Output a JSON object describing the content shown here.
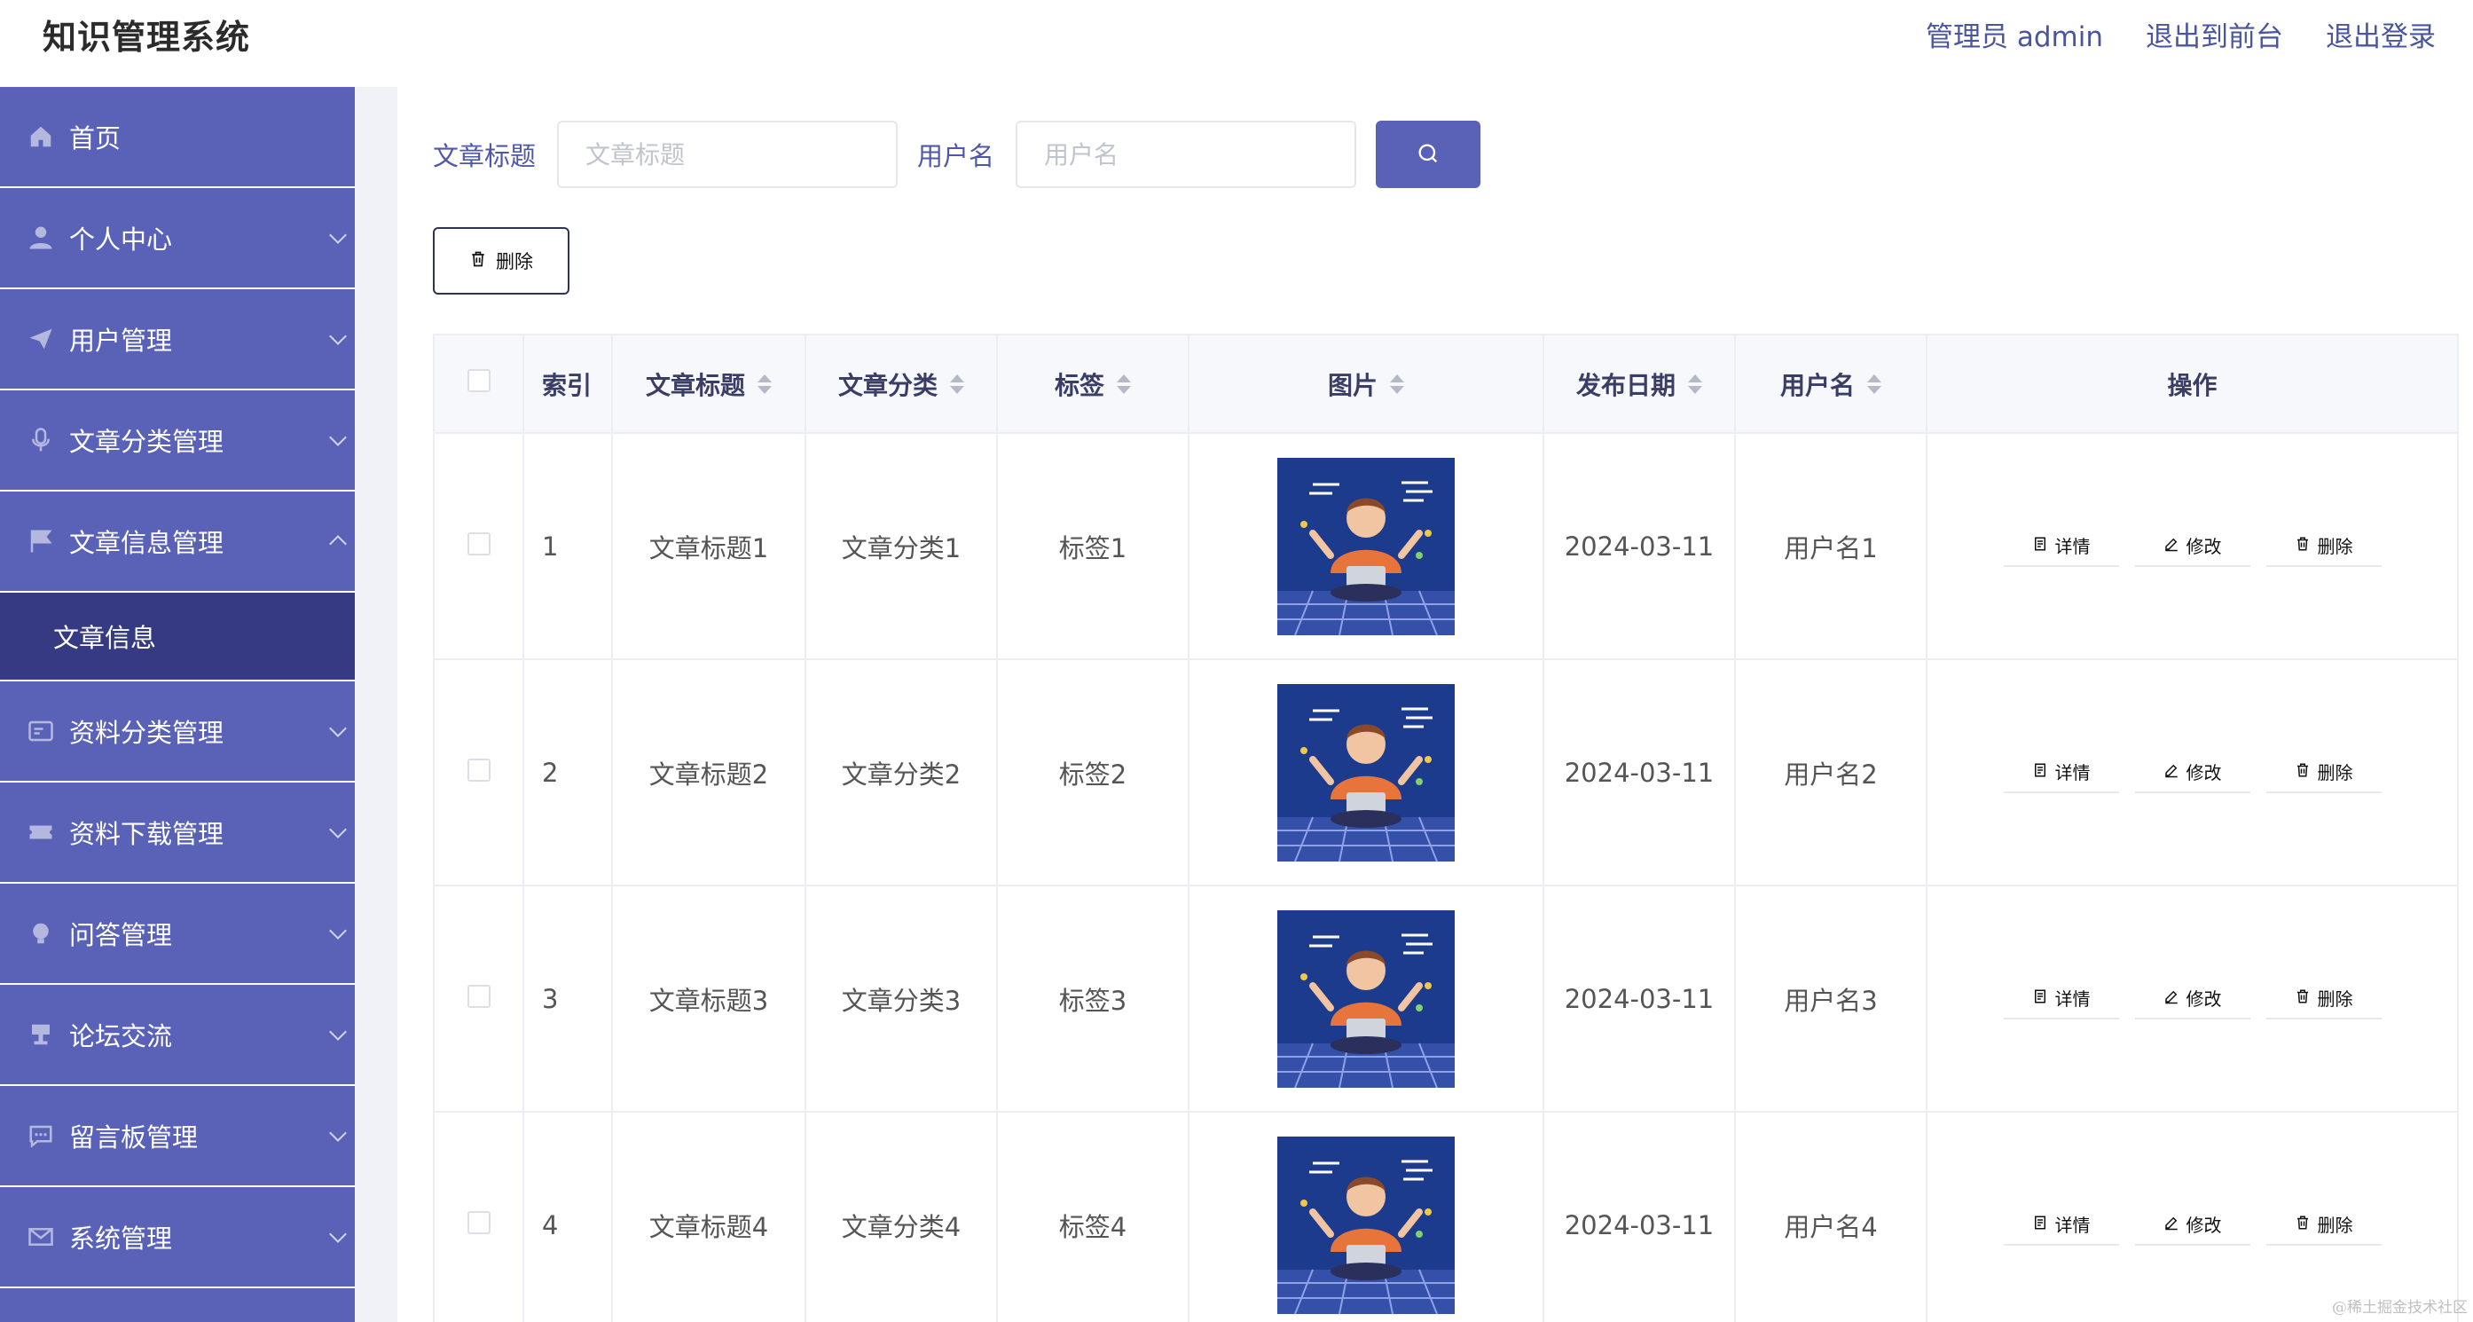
{
  "header": {
    "app_title": "知识管理系统",
    "admin_label": "管理员 admin",
    "back_to_front": "退出到前台",
    "logout": "退出登录"
  },
  "sidebar": {
    "items": [
      {
        "label": "首页",
        "icon": "home-icon"
      },
      {
        "label": "个人中心",
        "icon": "user-icon"
      },
      {
        "label": "用户管理",
        "icon": "paper-plane-icon"
      },
      {
        "label": "文章分类管理",
        "icon": "microphone-icon"
      },
      {
        "label": "文章信息管理",
        "icon": "flag-icon"
      },
      {
        "label": "资料分类管理",
        "icon": "id-card-icon"
      },
      {
        "label": "资料下载管理",
        "icon": "ticket-icon"
      },
      {
        "label": "问答管理",
        "icon": "bulb-icon"
      },
      {
        "label": "论坛交流",
        "icon": "stamp-icon"
      },
      {
        "label": "留言板管理",
        "icon": "chat-icon"
      },
      {
        "label": "系统管理",
        "icon": "mail-icon"
      }
    ],
    "sub_item": "文章信息"
  },
  "search": {
    "title_label": "文章标题",
    "title_placeholder": "文章标题",
    "user_label": "用户名",
    "user_placeholder": "用户名"
  },
  "toolbar": {
    "delete_label": "删除"
  },
  "table": {
    "columns": [
      "索引",
      "文章标题",
      "文章分类",
      "标签",
      "图片",
      "发布日期",
      "用户名",
      "操作"
    ],
    "rows": [
      {
        "index": "1",
        "title": "文章标题1",
        "category": "文章分类1",
        "tag": "标签1",
        "date": "2024-03-11",
        "user": "用户名1"
      },
      {
        "index": "2",
        "title": "文章标题2",
        "category": "文章分类2",
        "tag": "标签2",
        "date": "2024-03-11",
        "user": "用户名2"
      },
      {
        "index": "3",
        "title": "文章标题3",
        "category": "文章分类3",
        "tag": "标签3",
        "date": "2024-03-11",
        "user": "用户名3"
      },
      {
        "index": "4",
        "title": "文章标题4",
        "category": "文章分类4",
        "tag": "标签4",
        "date": "2024-03-11",
        "user": "用户名4"
      }
    ],
    "actions": {
      "detail": "详情",
      "edit": "修改",
      "delete": "删除"
    }
  },
  "watermark": "@稀土掘金技术社区",
  "colors": {
    "sidebar_bg": "#5a62b8",
    "sidebar_active": "#363a83",
    "accent": "#5a62b8",
    "header_link": "#4a55a0"
  }
}
